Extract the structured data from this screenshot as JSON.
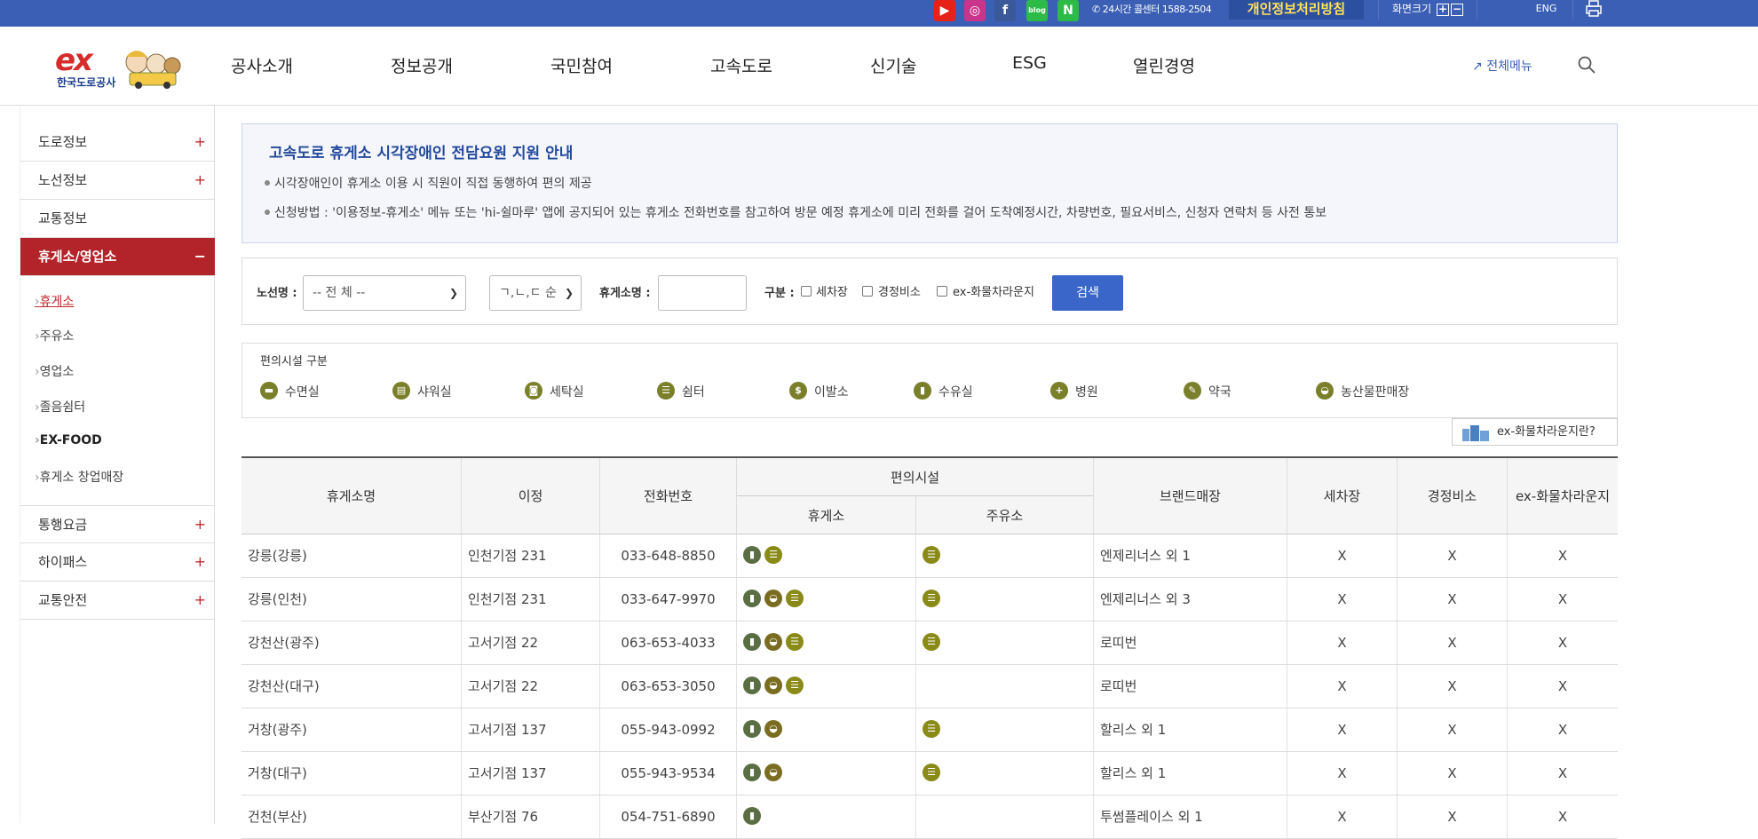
{
  "topbar": {
    "sns": [
      {
        "name": "youtube-icon",
        "glyph": "▶",
        "color": "#e62117"
      },
      {
        "name": "instagram-icon",
        "glyph": "◎",
        "color": "#c8358a"
      },
      {
        "name": "facebook-icon",
        "glyph": "f",
        "color": "#3b5998"
      },
      {
        "name": "blog-icon",
        "glyph": "blog",
        "color": "#2dbb48"
      },
      {
        "name": "naver-post-icon",
        "glyph": "N",
        "color": "#2dbb48"
      }
    ],
    "phone": "24시간 콜센터 1588-2504",
    "privacy": "개인정보처리방침",
    "fontsize": "화면크기",
    "plus": "+",
    "minus": "−",
    "eng": "ENG"
  },
  "header": {
    "logo_text": "ex",
    "logo_name": "한국도로공사",
    "gnb": [
      "공사소개",
      "정보공개",
      "국민참여",
      "고속도로",
      "신기술",
      "ESG",
      "열린경영"
    ],
    "allmenu": "전체메뉴"
  },
  "lnb": {
    "items": [
      {
        "label": "도로정보",
        "plus": "+"
      },
      {
        "label": "노선정보",
        "plus": "+"
      },
      {
        "label": "교통정보",
        "plus": ""
      },
      {
        "label": "휴게소/영업소",
        "plus": "−"
      }
    ],
    "subs": [
      "휴게소",
      "주유소",
      "영업소",
      "졸음쉼터",
      "EX-FOOD",
      "휴게소 창업매장"
    ],
    "items2": [
      {
        "label": "통행요금",
        "plus": "+"
      },
      {
        "label": "하이패스",
        "plus": "+"
      },
      {
        "label": "교통안전",
        "plus": "+"
      }
    ]
  },
  "notice": {
    "title": "고속도로 휴게소 시각장애인 전담요원 지원 안내",
    "lines": [
      "시각장애인이 휴게소 이용 시 직원이 직접 동행하여 편의 제공",
      "신청방법 : '이용정보-휴게소' 메뉴 또는 'hi-쉴마루' 앱에 공지되어 있는 휴게소 전화번호를 참고하여 방문 예정 휴게소에 미리 전화를 걸어 도착예정시간, 차량번호, 필요서비스, 신청자 연락처 등 사전 통보"
    ]
  },
  "filter": {
    "route_label": "노선명 :",
    "route_value": "-- 전 체 --",
    "order_value": "ㄱ,ㄴ,ㄷ 순",
    "name_label": "휴게소명 :",
    "name_value": "",
    "type_label": "구분 :",
    "checks": [
      "세차장",
      "경정비소",
      "ex-화물차라운지"
    ],
    "search": "검색"
  },
  "legend": {
    "title": "편의시설 구분",
    "items": [
      {
        "label": "수면실",
        "icon": "bed-icon",
        "glyph": "▬"
      },
      {
        "label": "샤워실",
        "icon": "shower-icon",
        "glyph": "▤"
      },
      {
        "label": "세탁실",
        "icon": "laundry-icon",
        "glyph": "◙"
      },
      {
        "label": "쉼터",
        "icon": "shelter-icon",
        "glyph": "☰"
      },
      {
        "label": "이발소",
        "icon": "barber-icon",
        "glyph": "$"
      },
      {
        "label": "수유실",
        "icon": "nursing-room-icon",
        "glyph": "▮"
      },
      {
        "label": "병원",
        "icon": "hospital-icon",
        "glyph": "+"
      },
      {
        "label": "약국",
        "icon": "pharmacy-icon",
        "glyph": "✎"
      },
      {
        "label": "농산물판매장",
        "icon": "farm-store-icon",
        "glyph": "◒"
      }
    ],
    "truck_lounge_btn": "ex-화물차라운지란?"
  },
  "table": {
    "headers": {
      "name": "휴게소명",
      "distance": "이정",
      "phone": "전화번호",
      "facilities": "편의시설",
      "rest": "휴게소",
      "gas": "주유소",
      "brand": "브랜드매장",
      "carwash": "세차장",
      "repair": "경정비소",
      "truck": "ex-화물차라운지"
    },
    "rows": [
      {
        "name": "강릉(강릉)",
        "distance": "인천기점 231",
        "phone": "033-648-8850",
        "rest": [
          "nursing",
          "shelter"
        ],
        "gas": [
          "shelter"
        ],
        "brand": "엔제리너스 외 1",
        "carwash": "X",
        "repair": "X",
        "truck": "X"
      },
      {
        "name": "강릉(인천)",
        "distance": "인천기점 231",
        "phone": "033-647-9970",
        "rest": [
          "nursing",
          "farm",
          "shelter"
        ],
        "gas": [
          "shelter"
        ],
        "brand": "엔제리너스 외 3",
        "carwash": "X",
        "repair": "X",
        "truck": "X"
      },
      {
        "name": "강천산(광주)",
        "distance": "고서기점 22",
        "phone": "063-653-4033",
        "rest": [
          "nursing",
          "farm",
          "shelter"
        ],
        "gas": [
          "shelter"
        ],
        "brand": "로띠번",
        "carwash": "X",
        "repair": "X",
        "truck": "X"
      },
      {
        "name": "강천산(대구)",
        "distance": "고서기점 22",
        "phone": "063-653-3050",
        "rest": [
          "nursing",
          "farm",
          "shelter"
        ],
        "gas": [],
        "brand": "로띠번",
        "carwash": "X",
        "repair": "X",
        "truck": "X"
      },
      {
        "name": "거창(광주)",
        "distance": "고서기점 137",
        "phone": "055-943-0992",
        "rest": [
          "nursing",
          "farm"
        ],
        "gas": [
          "shelter"
        ],
        "brand": "할리스 외 1",
        "carwash": "X",
        "repair": "X",
        "truck": "X"
      },
      {
        "name": "거창(대구)",
        "distance": "고서기점 137",
        "phone": "055-943-9534",
        "rest": [
          "nursing",
          "farm"
        ],
        "gas": [
          "shelter"
        ],
        "brand": "할리스 외 1",
        "carwash": "X",
        "repair": "X",
        "truck": "X"
      },
      {
        "name": "건천(부산)",
        "distance": "부산기점 76",
        "phone": "054-751-6890",
        "rest": [
          "nursing"
        ],
        "gas": [],
        "brand": "투썸플레이스 외 1",
        "carwash": "X",
        "repair": "X",
        "truck": "X"
      }
    ]
  }
}
